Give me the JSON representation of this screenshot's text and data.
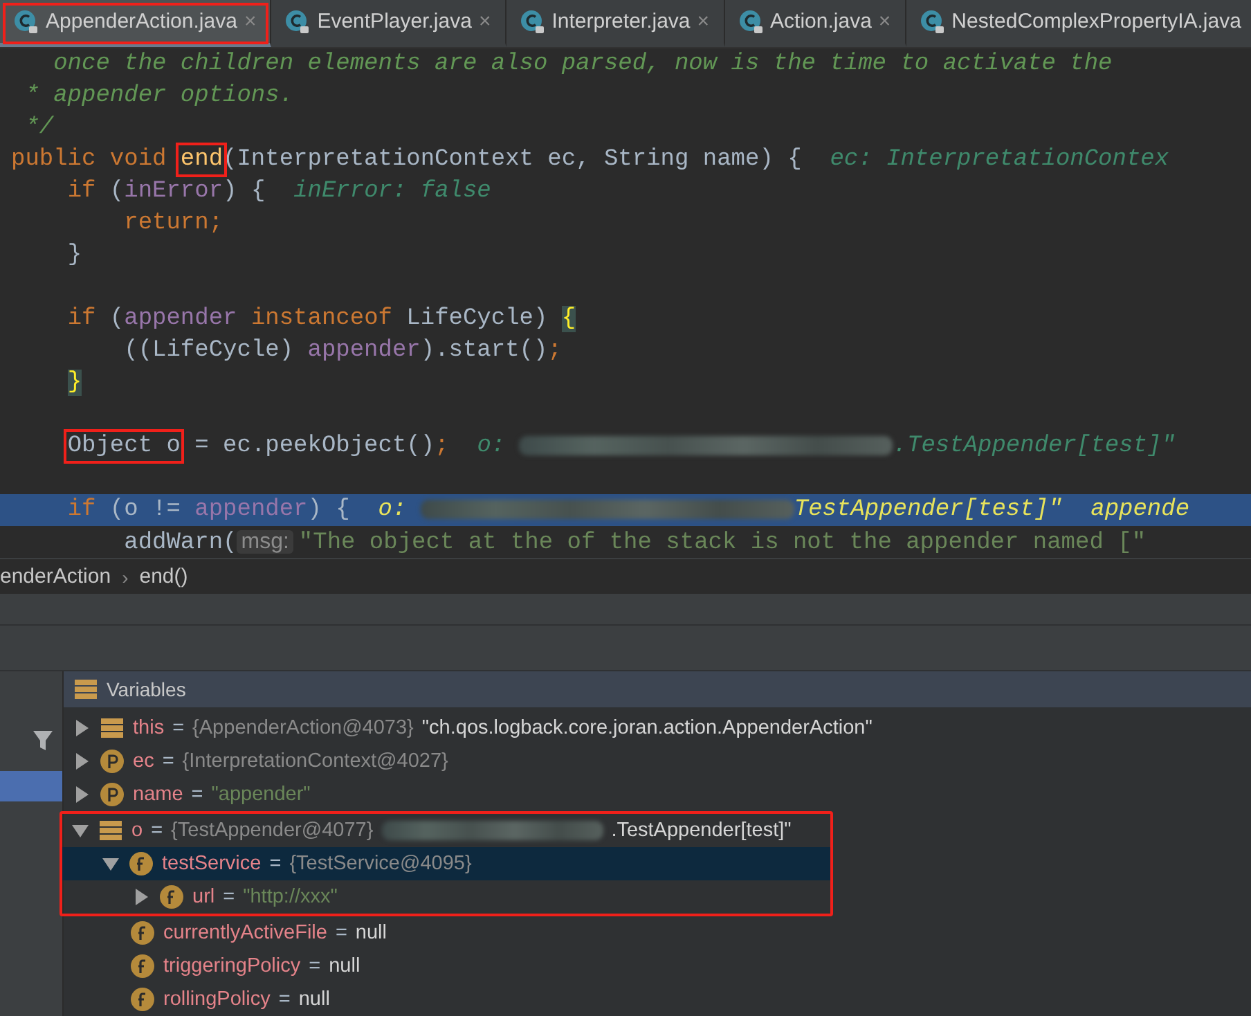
{
  "tabs": [
    {
      "label": "AppenderAction.java",
      "selected": true,
      "closable": true,
      "annotated": true
    },
    {
      "label": "EventPlayer.java",
      "selected": false,
      "closable": true,
      "annotated": false
    },
    {
      "label": "Interpreter.java",
      "selected": false,
      "closable": true,
      "annotated": false
    },
    {
      "label": "Action.java",
      "selected": false,
      "closable": true,
      "annotated": false
    },
    {
      "label": "NestedComplexPropertyIA.java",
      "selected": false,
      "closable": false,
      "annotated": false
    }
  ],
  "close_glyph": "×",
  "code": [
    {
      "highlighted": false,
      "tokens": [
        {
          "kind": "comment",
          "text": "   once the children elements are also parsed, now is the time to activate the"
        }
      ]
    },
    {
      "highlighted": false,
      "tokens": [
        {
          "kind": "comment",
          "text": " * appender options."
        }
      ]
    },
    {
      "highlighted": false,
      "tokens": [
        {
          "kind": "comment",
          "text": " */"
        }
      ]
    },
    {
      "highlighted": false,
      "tokens": [
        {
          "kind": "keyword",
          "text": "public void "
        },
        {
          "kind": "method",
          "text": "end",
          "annotated": true
        },
        {
          "kind": "plain",
          "text": "(InterpretationContext ec, String name) {"
        },
        {
          "kind": "hint",
          "text": "  ec: InterpretationContex"
        }
      ]
    },
    {
      "highlighted": false,
      "tokens": [
        {
          "kind": "keyword",
          "text": "    if "
        },
        {
          "kind": "plain",
          "text": "("
        },
        {
          "kind": "field",
          "text": "inError"
        },
        {
          "kind": "plain",
          "text": ") {"
        },
        {
          "kind": "hint",
          "text": "  inError: false"
        }
      ]
    },
    {
      "highlighted": false,
      "tokens": [
        {
          "kind": "keyword",
          "text": "        return;"
        }
      ]
    },
    {
      "highlighted": false,
      "tokens": [
        {
          "kind": "plain",
          "text": "    }"
        }
      ]
    },
    {
      "highlighted": false
    },
    {
      "highlighted": false,
      "tokens": [
        {
          "kind": "keyword",
          "text": "    if "
        },
        {
          "kind": "plain",
          "text": "("
        },
        {
          "kind": "field",
          "text": "appender"
        },
        {
          "kind": "keyword",
          "text": " instanceof "
        },
        {
          "kind": "plain",
          "text": "LifeCycle) "
        },
        {
          "kind": "brace",
          "text": "{"
        }
      ]
    },
    {
      "highlighted": false,
      "tokens": [
        {
          "kind": "plain",
          "text": "        ((LifeCycle) "
        },
        {
          "kind": "field",
          "text": "appender"
        },
        {
          "kind": "plain",
          "text": ").start()"
        },
        {
          "kind": "keyword",
          "text": ";"
        }
      ]
    },
    {
      "highlighted": false,
      "tokens": [
        {
          "kind": "brace",
          "text": "    }"
        }
      ]
    },
    {
      "highlighted": false
    },
    {
      "highlighted": false,
      "tokens": [
        {
          "kind": "plain",
          "text": "    Object o",
          "annotated": true
        },
        {
          "kind": "plain",
          "text": " = ec.peekObject()"
        },
        {
          "kind": "keyword",
          "text": ";"
        },
        {
          "kind": "hint",
          "text": "  o: "
        },
        {
          "kind": "redaction"
        },
        {
          "kind": "hint",
          "text": ".TestAppender[test]\""
        }
      ]
    },
    {
      "highlighted": false
    },
    {
      "highlighted": true,
      "tokens": [
        {
          "kind": "keyword",
          "text": "    if "
        },
        {
          "kind": "plain",
          "text": "(o != "
        },
        {
          "kind": "field",
          "text": "appender"
        },
        {
          "kind": "plain",
          "text": ") {"
        },
        {
          "kind": "hint",
          "text": "  o: "
        },
        {
          "kind": "redaction"
        },
        {
          "kind": "hint",
          "text": "TestAppender[test]\"  appende"
        }
      ]
    },
    {
      "highlighted": false,
      "tokens": [
        {
          "kind": "plain",
          "text": "        addWarn("
        },
        {
          "kind": "paramhint",
          "text": "msg:"
        },
        {
          "kind": "string",
          "text": "\"The object at the of the stack is not the appender named [\""
        }
      ]
    }
  ],
  "breadcrumb": [
    "enderAction",
    "end()"
  ],
  "breadcrumb_separator": "›",
  "variables": {
    "title": "Variables",
    "assign_sign": "=",
    "items": [
      {
        "kind": "local",
        "name": "this",
        "type": "{AppenderAction@4073}",
        "value": "\"ch.qos.logback.core.joran.action.AppenderAction\"",
        "string": false,
        "expanded": false,
        "selected": false,
        "annotated": false
      },
      {
        "kind": "param",
        "name": "ec",
        "type": "{InterpretationContext@4027}",
        "expanded": false,
        "selected": false,
        "annotated": false
      },
      {
        "kind": "param",
        "name": "name",
        "value": "\"appender\"",
        "string": true,
        "expanded": false,
        "selected": false,
        "annotated": false
      },
      {
        "kind": "local",
        "name": "o",
        "type": "{TestAppender@4077}",
        "redacted": true,
        "value": ".TestAppender[test]\"",
        "string": false,
        "expanded": true,
        "selected": false,
        "annotated": true,
        "children": [
          {
            "kind": "field",
            "name": "testService",
            "type": "{TestService@4095}",
            "expanded": true,
            "selected": true,
            "annotated": true,
            "children": [
              {
                "kind": "field",
                "name": "url",
                "value": "\"http://xxx\"",
                "string": true,
                "expanded": false,
                "selected": false,
                "annotated": true
              }
            ]
          },
          {
            "kind": "field",
            "name": "currentlyActiveFile",
            "value": "null",
            "string": false,
            "selected": false,
            "annotated": false
          },
          {
            "kind": "field",
            "name": "triggeringPolicy",
            "value": "null",
            "string": false,
            "selected": false,
            "annotated": false
          },
          {
            "kind": "field",
            "name": "rollingPolicy",
            "value": "null",
            "string": false,
            "selected": false,
            "annotated": false
          }
        ]
      }
    ]
  }
}
